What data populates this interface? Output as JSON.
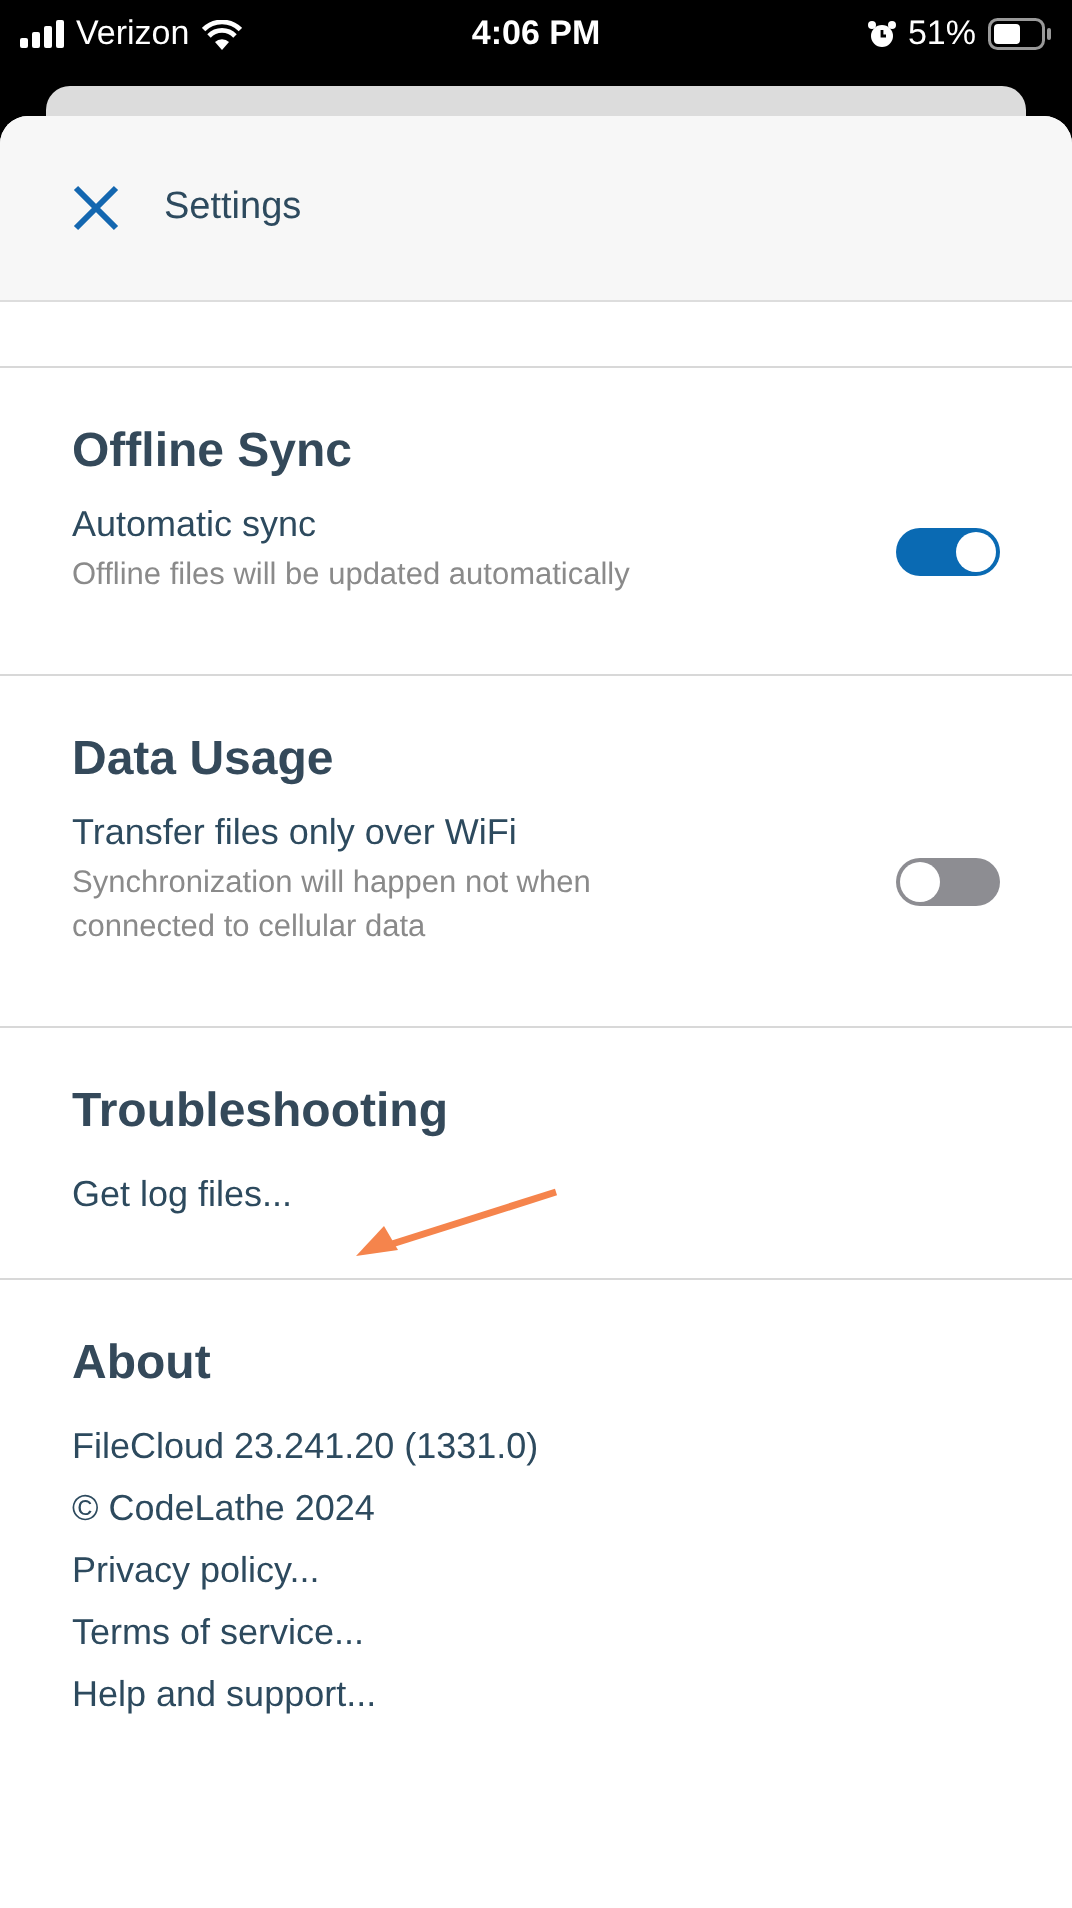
{
  "status_bar": {
    "carrier": "Verizon",
    "time": "4:06 PM",
    "battery": "51%"
  },
  "header": {
    "title": "Settings"
  },
  "sections": [
    {
      "title": "Offline Sync",
      "items": [
        {
          "kind": "toggle",
          "label": "Automatic sync",
          "description": "Offline files will be updated automatically",
          "on": true
        }
      ]
    },
    {
      "title": "Data Usage",
      "items": [
        {
          "kind": "toggle",
          "label": "Transfer files only over WiFi",
          "description": "Synchronization will happen not when connected to cellular data",
          "on": false
        }
      ]
    },
    {
      "title": "Troubleshooting",
      "items": [
        {
          "kind": "link",
          "label": "Get log files..."
        }
      ]
    },
    {
      "title": "About",
      "items": [
        {
          "kind": "text",
          "label": "FileCloud 23.241.20 (1331.0)"
        },
        {
          "kind": "text",
          "label": "© CodeLathe 2024"
        },
        {
          "kind": "link",
          "label": "Privacy policy..."
        },
        {
          "kind": "link",
          "label": "Terms of service..."
        },
        {
          "kind": "link",
          "label": "Help and support..."
        }
      ]
    }
  ]
}
